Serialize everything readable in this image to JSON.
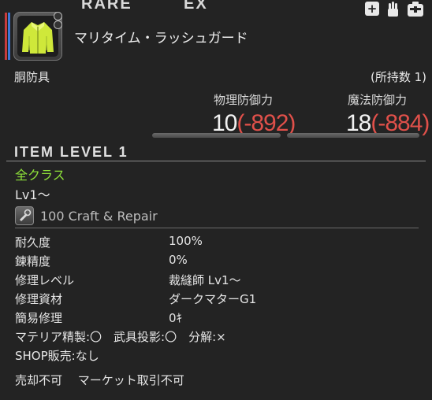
{
  "header": {
    "rarity_left": "RARE",
    "rarity_right": "EX",
    "icons": [
      "plus-icon",
      "hand-icon",
      "inventory-icon"
    ]
  },
  "item": {
    "name": "マリタイム・ラッシュガード",
    "category": "胴防具",
    "owned": "(所持数 1)"
  },
  "stats": {
    "physical": {
      "label": "物理防御力",
      "value": "10",
      "diff": "(-892)"
    },
    "magic": {
      "label": "魔法防御力",
      "value": "18",
      "diff": "(-884)"
    }
  },
  "item_level": "ITEM LEVEL  1",
  "classes": "全クラス",
  "level": "Lv1～",
  "craft": {
    "text": "100 Craft & Repair",
    "icon": "craft-repair-icon"
  },
  "details": [
    {
      "label": "耐久度",
      "value": "100%"
    },
    {
      "label": "錬精度",
      "value": "0%"
    },
    {
      "label": "修理レベル",
      "value": "裁縫師 Lv1～"
    },
    {
      "label": "修理資材",
      "value": "ダークマターG1"
    },
    {
      "label": "簡易修理",
      "value": "0ｷ"
    }
  ],
  "flags": {
    "materia_line": "マテリア精製:〇　武具投影:〇　分解:×",
    "shop_line": "SHOP販売:なし",
    "trade_line": "売却不可　 マーケット取引不可"
  },
  "colors": {
    "background": "#232323",
    "class_text": "#8ee13a",
    "stat_diff": "#e0504a",
    "stripe_red": "#c83c3c",
    "stripe_blue": "#3c78d8"
  }
}
